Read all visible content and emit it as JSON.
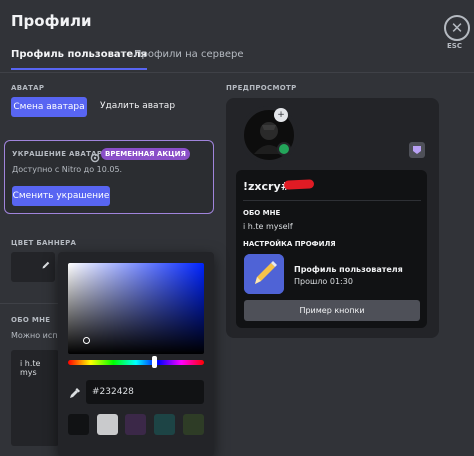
{
  "header": {
    "title": "Профили",
    "esc_label": "ESC"
  },
  "tabs": {
    "user_profile": "Профиль пользователя",
    "server_profiles": "Профили на сервере"
  },
  "avatar_section": {
    "label": "АВАТАР",
    "change_button": "Смена аватара",
    "remove_button": "Удалить аватар"
  },
  "decoration": {
    "label": "УКРАШЕНИЕ АВАТАРА",
    "badge": "ВРЕМЕННАЯ АКЦИЯ",
    "availability": "Доступно с Nitro до 10.05.",
    "button": "Сменить украшение"
  },
  "banner_section": {
    "label": "ЦВЕТ БАННЕРА"
  },
  "about_section": {
    "label": "ОБО МНЕ",
    "hint": "Можно испо",
    "value": "i h.te mys"
  },
  "preview": {
    "label": "ПРЕДПРОСМОТР",
    "username": "!zxcry#",
    "about_label": "ОБО МНЕ",
    "about_text": "i h.te myself",
    "activity_label": "НАСТРОЙКА ПРОФИЛЯ",
    "activity_title": "Профиль пользователя",
    "activity_time": "Прошло 01:30",
    "example_button": "Пример кнопки"
  },
  "color_picker": {
    "hex_value": "#232428",
    "presets": [
      "#111214",
      "#c9cacc",
      "#3b2848",
      "#1d4445",
      "#2e3c26"
    ]
  },
  "colors": {
    "accent": "#5865f2",
    "nitro_purple": "#a084dc",
    "online": "#23a55a"
  }
}
